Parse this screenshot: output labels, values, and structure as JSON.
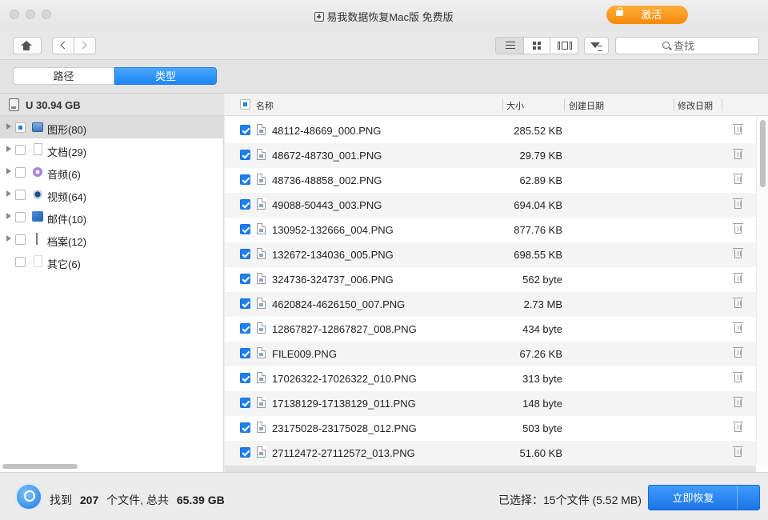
{
  "window": {
    "title": "易我数据恢复Mac版 免费版",
    "activate_label": "激活"
  },
  "toolbar": {
    "search_placeholder": "查找"
  },
  "view_tabs": [
    {
      "label": "路径",
      "active": false
    },
    {
      "label": "类型",
      "active": true
    }
  ],
  "sidebar": {
    "drive_label": "U 30.94 GB",
    "items": [
      {
        "label": "图形(80)",
        "icon": "image-folder-icon",
        "selected": true,
        "state": "partial",
        "expandable": true
      },
      {
        "label": "文档(29)",
        "icon": "document-icon",
        "selected": false,
        "state": "unchecked",
        "expandable": true
      },
      {
        "label": "音频(6)",
        "icon": "music-icon",
        "selected": false,
        "state": "unchecked",
        "expandable": true
      },
      {
        "label": "视频(64)",
        "icon": "video-icon",
        "selected": false,
        "state": "unchecked",
        "expandable": true
      },
      {
        "label": "邮件(10)",
        "icon": "mail-icon",
        "selected": false,
        "state": "unchecked",
        "expandable": true
      },
      {
        "label": "档案(12)",
        "icon": "archive-icon",
        "selected": false,
        "state": "unchecked",
        "expandable": true
      },
      {
        "label": "其它(6)",
        "icon": "blank-file-icon",
        "selected": false,
        "state": "unchecked",
        "expandable": false
      }
    ]
  },
  "table": {
    "columns": {
      "name": "名称",
      "size": "大小",
      "created": "创建日期",
      "modified": "修改日期"
    },
    "rows": [
      {
        "name": "48112-48669_000.PNG",
        "size": "285.52 KB"
      },
      {
        "name": "48672-48730_001.PNG",
        "size": "29.79 KB"
      },
      {
        "name": "48736-48858_002.PNG",
        "size": "62.89 KB"
      },
      {
        "name": "49088-50443_003.PNG",
        "size": "694.04 KB"
      },
      {
        "name": "130952-132666_004.PNG",
        "size": "877.76 KB"
      },
      {
        "name": "132672-134036_005.PNG",
        "size": "698.55 KB"
      },
      {
        "name": "324736-324737_006.PNG",
        "size": "562 byte"
      },
      {
        "name": "4620824-4626150_007.PNG",
        "size": "2.73 MB"
      },
      {
        "name": "12867827-12867827_008.PNG",
        "size": "434 byte"
      },
      {
        "name": "FILE009.PNG",
        "size": "67.26 KB"
      },
      {
        "name": "17026322-17026322_010.PNG",
        "size": "313 byte"
      },
      {
        "name": "17138129-17138129_011.PNG",
        "size": "148 byte"
      },
      {
        "name": "23175028-23175028_012.PNG",
        "size": "503 byte"
      },
      {
        "name": "27112472-27112572_013.PNG",
        "size": "51.60 KB"
      }
    ]
  },
  "footer": {
    "found_prefix": "找到",
    "found_count": "207",
    "found_middle": "个文件, 总共",
    "found_total": "65.39 GB",
    "selected_text": "已选择：15个文件 (5.52 MB)",
    "recover_label": "立即恢复"
  },
  "colors": {
    "accent": "#1e7ff0",
    "activate": "#f58a0b"
  }
}
